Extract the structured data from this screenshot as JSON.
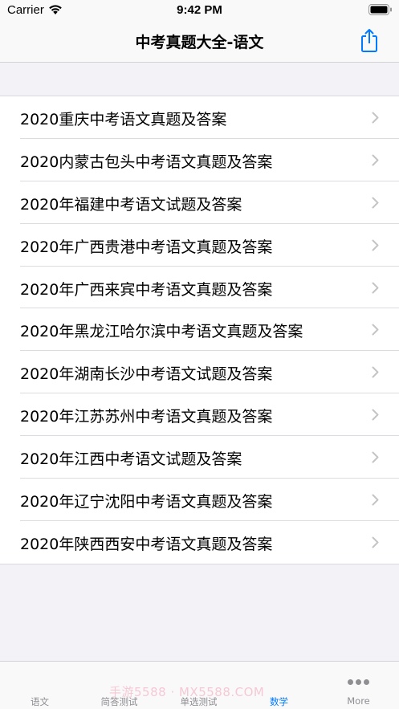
{
  "status_bar": {
    "carrier": "Carrier",
    "time": "9:42 PM"
  },
  "nav": {
    "title": "中考真题大全-语文",
    "share_icon": "share-icon"
  },
  "list": {
    "items": [
      {
        "label": "2020重庆中考语文真题及答案"
      },
      {
        "label": "2020内蒙古包头中考语文真题及答案"
      },
      {
        "label": "2020年福建中考语文试题及答案"
      },
      {
        "label": "2020年广西贵港中考语文真题及答案"
      },
      {
        "label": "2020年广西来宾中考语文真题及答案"
      },
      {
        "label": "2020年黑龙江哈尔滨中考语文真题及答案"
      },
      {
        "label": "2020年湖南长沙中考语文试题及答案"
      },
      {
        "label": "2020年江苏苏州中考语文真题及答案"
      },
      {
        "label": "2020年江西中考语文试题及答案"
      },
      {
        "label": "2020年辽宁沈阳中考语文真题及答案"
      },
      {
        "label": "2020年陕西西安中考语文真题及答案"
      }
    ]
  },
  "tab_bar": {
    "tabs": [
      {
        "label": "语文",
        "active": false
      },
      {
        "label": "简答测试",
        "active": false
      },
      {
        "label": "单选测试",
        "active": false
      },
      {
        "label": "数学",
        "active": true
      },
      {
        "label": "More",
        "active": false
      }
    ],
    "watermark": "手游5588 · MX5588.COM"
  },
  "colors": {
    "accent": "#007aff",
    "inactive": "#8e8e93",
    "background": "#f2f2f7"
  }
}
